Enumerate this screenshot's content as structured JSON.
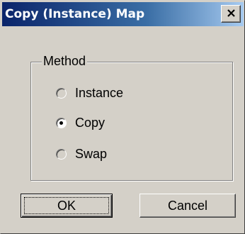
{
  "window": {
    "title": "Copy (Instance) Map",
    "close_symbol": "X"
  },
  "method_group": {
    "label": "Method",
    "options": [
      {
        "label": "Instance",
        "selected": false
      },
      {
        "label": "Copy",
        "selected": true
      },
      {
        "label": "Swap",
        "selected": false
      }
    ]
  },
  "buttons": {
    "ok_label": "OK",
    "cancel_label": "Cancel"
  },
  "colors": {
    "title_bar_start": "#0a246a",
    "title_bar_end": "#a6caf0",
    "face": "#d4d0c8"
  }
}
